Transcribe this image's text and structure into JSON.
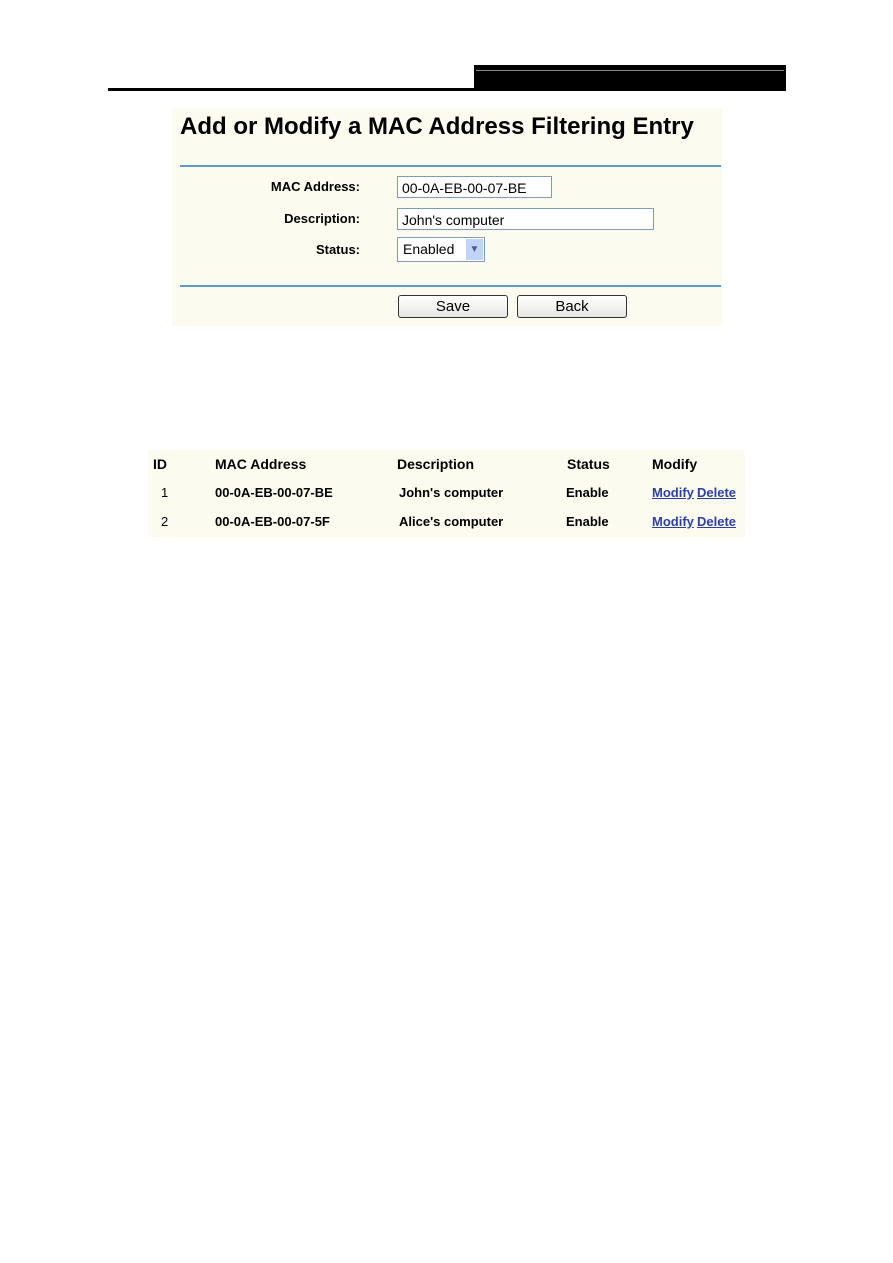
{
  "form": {
    "title": "Add or Modify a MAC Address Filtering Entry",
    "mac_label": "MAC Address:",
    "mac_value": "00-0A-EB-00-07-BE",
    "desc_label": "Description:",
    "desc_value": "John's computer",
    "status_label": "Status:",
    "status_value": "Enabled",
    "save": "Save",
    "back": "Back"
  },
  "table": {
    "headers": [
      "ID",
      "MAC Address",
      "Description",
      "Status",
      "Modify"
    ],
    "rows": [
      {
        "id": "1",
        "mac": "00-0A-EB-00-07-BE",
        "desc": "John's computer",
        "status": "Enable",
        "modify": "Modify",
        "delete": "Delete"
      },
      {
        "id": "2",
        "mac": "00-0A-EB-00-07-5F",
        "desc": "Alice's computer",
        "status": "Enable",
        "modify": "Modify",
        "delete": "Delete"
      }
    ]
  },
  "colors": {
    "rule": "#5a9ac6",
    "panel_bg": "#fbfbef",
    "link": "#2d3fa5"
  }
}
